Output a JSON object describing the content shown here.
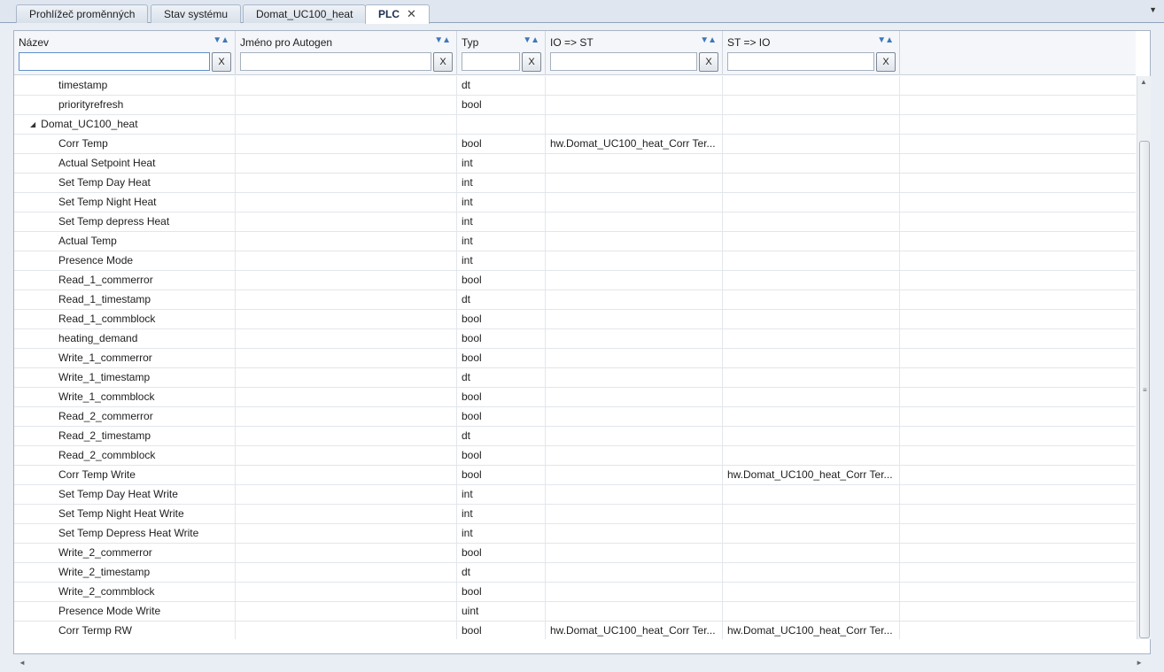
{
  "tabs": [
    {
      "label": "Prohlížeč proměnných",
      "active": false
    },
    {
      "label": "Stav systému",
      "active": false
    },
    {
      "label": "Domat_UC100_heat",
      "active": false
    },
    {
      "label": "PLC",
      "active": true
    }
  ],
  "columns": [
    {
      "title": "Název",
      "filter": ""
    },
    {
      "title": "Jméno pro Autogen",
      "filter": ""
    },
    {
      "title": "Typ",
      "filter": ""
    },
    {
      "title": "IO => ST",
      "filter": ""
    },
    {
      "title": "ST => IO",
      "filter": ""
    }
  ],
  "clear_label": "X",
  "sort_glyph": "▼▲",
  "rows": [
    {
      "name": "timestamp",
      "autogen": "",
      "type": "dt",
      "io_st": "",
      "st_io": ""
    },
    {
      "name": "priorityrefresh",
      "autogen": "",
      "type": "bool",
      "io_st": "",
      "st_io": ""
    },
    {
      "name": "Domat_UC100_heat",
      "group": true,
      "autogen": "",
      "type": "",
      "io_st": "",
      "st_io": ""
    },
    {
      "name": "Corr Temp",
      "autogen": "",
      "type": "bool",
      "io_st": "hw.Domat_UC100_heat_Corr Ter...",
      "st_io": ""
    },
    {
      "name": "Actual Setpoint Heat",
      "autogen": "",
      "type": "int",
      "io_st": "",
      "st_io": ""
    },
    {
      "name": "Set Temp Day Heat",
      "autogen": "",
      "type": "int",
      "io_st": "",
      "st_io": ""
    },
    {
      "name": "Set Temp Night Heat",
      "autogen": "",
      "type": "int",
      "io_st": "",
      "st_io": ""
    },
    {
      "name": "Set Temp depress Heat",
      "autogen": "",
      "type": "int",
      "io_st": "",
      "st_io": ""
    },
    {
      "name": "Actual Temp",
      "autogen": "",
      "type": "int",
      "io_st": "",
      "st_io": ""
    },
    {
      "name": "Presence Mode",
      "autogen": "",
      "type": "int",
      "io_st": "",
      "st_io": ""
    },
    {
      "name": "Read_1_commerror",
      "autogen": "",
      "type": "bool",
      "io_st": "",
      "st_io": ""
    },
    {
      "name": "Read_1_timestamp",
      "autogen": "",
      "type": "dt",
      "io_st": "",
      "st_io": ""
    },
    {
      "name": "Read_1_commblock",
      "autogen": "",
      "type": "bool",
      "io_st": "",
      "st_io": ""
    },
    {
      "name": "heating_demand",
      "autogen": "",
      "type": "bool",
      "io_st": "",
      "st_io": ""
    },
    {
      "name": "Write_1_commerror",
      "autogen": "",
      "type": "bool",
      "io_st": "",
      "st_io": ""
    },
    {
      "name": "Write_1_timestamp",
      "autogen": "",
      "type": "dt",
      "io_st": "",
      "st_io": ""
    },
    {
      "name": "Write_1_commblock",
      "autogen": "",
      "type": "bool",
      "io_st": "",
      "st_io": ""
    },
    {
      "name": "Read_2_commerror",
      "autogen": "",
      "type": "bool",
      "io_st": "",
      "st_io": ""
    },
    {
      "name": "Read_2_timestamp",
      "autogen": "",
      "type": "dt",
      "io_st": "",
      "st_io": ""
    },
    {
      "name": "Read_2_commblock",
      "autogen": "",
      "type": "bool",
      "io_st": "",
      "st_io": ""
    },
    {
      "name": "Corr Temp Write",
      "autogen": "",
      "type": "bool",
      "io_st": "",
      "st_io": "hw.Domat_UC100_heat_Corr Ter..."
    },
    {
      "name": "Set Temp Day Heat Write",
      "autogen": "",
      "type": "int",
      "io_st": "",
      "st_io": ""
    },
    {
      "name": "Set Temp Night Heat Write",
      "autogen": "",
      "type": "int",
      "io_st": "",
      "st_io": ""
    },
    {
      "name": "Set Temp Depress Heat Write",
      "autogen": "",
      "type": "int",
      "io_st": "",
      "st_io": ""
    },
    {
      "name": "Write_2_commerror",
      "autogen": "",
      "type": "bool",
      "io_st": "",
      "st_io": ""
    },
    {
      "name": "Write_2_timestamp",
      "autogen": "",
      "type": "dt",
      "io_st": "",
      "st_io": ""
    },
    {
      "name": "Write_2_commblock",
      "autogen": "",
      "type": "bool",
      "io_st": "",
      "st_io": ""
    },
    {
      "name": "Presence Mode Write",
      "autogen": "",
      "type": "uint",
      "io_st": "",
      "st_io": ""
    },
    {
      "name": "Corr Termp RW",
      "autogen": "",
      "type": "bool",
      "io_st": "hw.Domat_UC100_heat_Corr Ter...",
      "st_io": "hw.Domat_UC100_heat_Corr Ter..."
    }
  ],
  "colors": {
    "accent": "#3e77b8",
    "grid_line": "#e2e6eb",
    "header_bg": "#f4f6f9"
  }
}
